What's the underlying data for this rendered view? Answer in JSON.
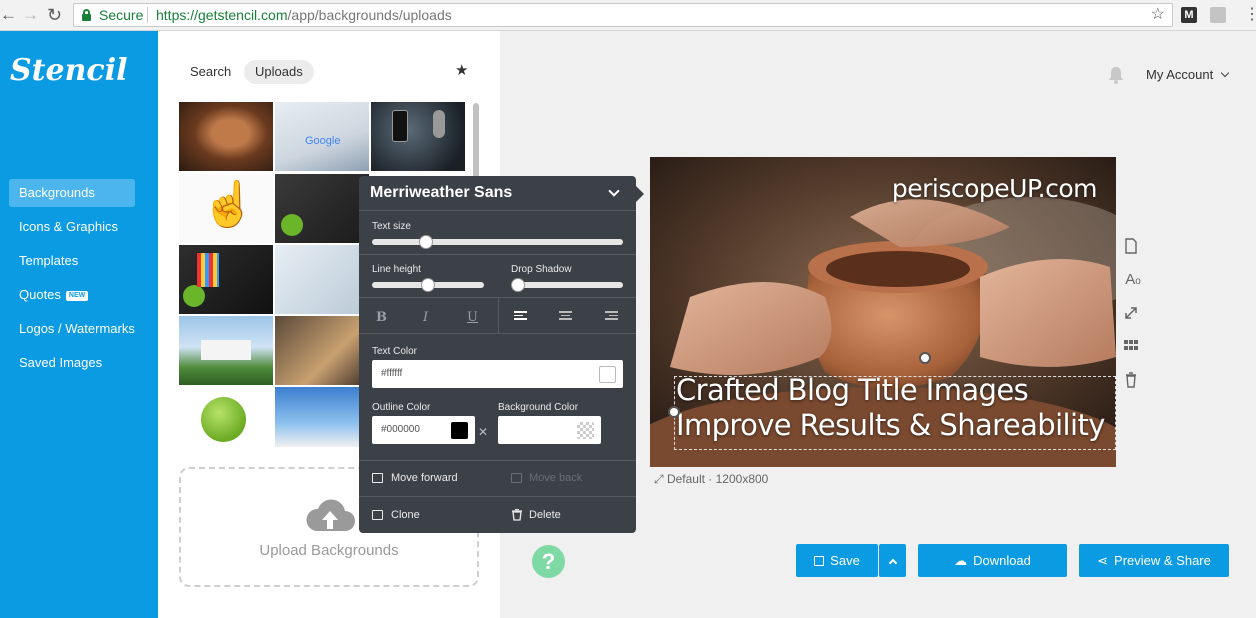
{
  "browser": {
    "secure_label": "Secure",
    "url_host": "https://getstencil.com",
    "url_path": "/app/backgrounds/uploads",
    "ext_label": "M"
  },
  "sidebar": {
    "logo": "Stencil",
    "items": [
      {
        "label": "Backgrounds",
        "active": true
      },
      {
        "label": "Icons & Graphics"
      },
      {
        "label": "Templates"
      },
      {
        "label": "Quotes",
        "badge": "NEW"
      },
      {
        "label": "Logos / Watermarks"
      },
      {
        "label": "Saved Images"
      }
    ]
  },
  "library": {
    "tabs": [
      "Search",
      "Uploads"
    ],
    "active_tab": "Uploads",
    "upload_label": "Upload Backgrounds"
  },
  "header": {
    "account_label": "My Account"
  },
  "canvas": {
    "watermark": "periscopeUP.com",
    "title_line1": "Crafted Blog Title Images",
    "title_line2": "Improve Results & Shareability",
    "size_label": "Default · 1200x800"
  },
  "popover": {
    "font_name": "Merriweather Sans",
    "text_size_label": "Text size",
    "text_size_value": 0.2,
    "line_height_label": "Line height",
    "line_height_value": 0.5,
    "drop_shadow_label": "Drop Shadow",
    "drop_shadow_value": 0.0,
    "bold_label": "B",
    "italic_label": "I",
    "underline_label": "U",
    "text_color_label": "Text Color",
    "text_color_value": "#ffffff",
    "outline_color_label": "Outline Color",
    "outline_color_value": "#000000",
    "background_color_label": "Background Color",
    "move_forward_label": "Move forward",
    "move_back_label": "Move back",
    "clone_label": "Clone",
    "delete_label": "Delete"
  },
  "actions": {
    "save_label": "Save",
    "download_label": "Download",
    "preview_label": "Preview & Share",
    "help_label": "?"
  },
  "colors": {
    "brand": "#0b9be3",
    "popover_bg": "#3c4047",
    "help": "#7ed9a4"
  }
}
